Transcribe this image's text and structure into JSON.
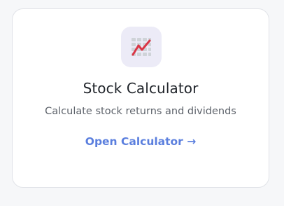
{
  "card": {
    "icon": "stock-chart-icon",
    "title": "Stock Calculator",
    "subtitle": "Calculate stock returns and dividends",
    "link_label": "Open Calculator →"
  },
  "colors": {
    "background": "#f6f7f9",
    "card": "#ffffff",
    "icon_tile": "#ecebf7",
    "trend_line": "#d93646",
    "link": "#5b7fde"
  }
}
